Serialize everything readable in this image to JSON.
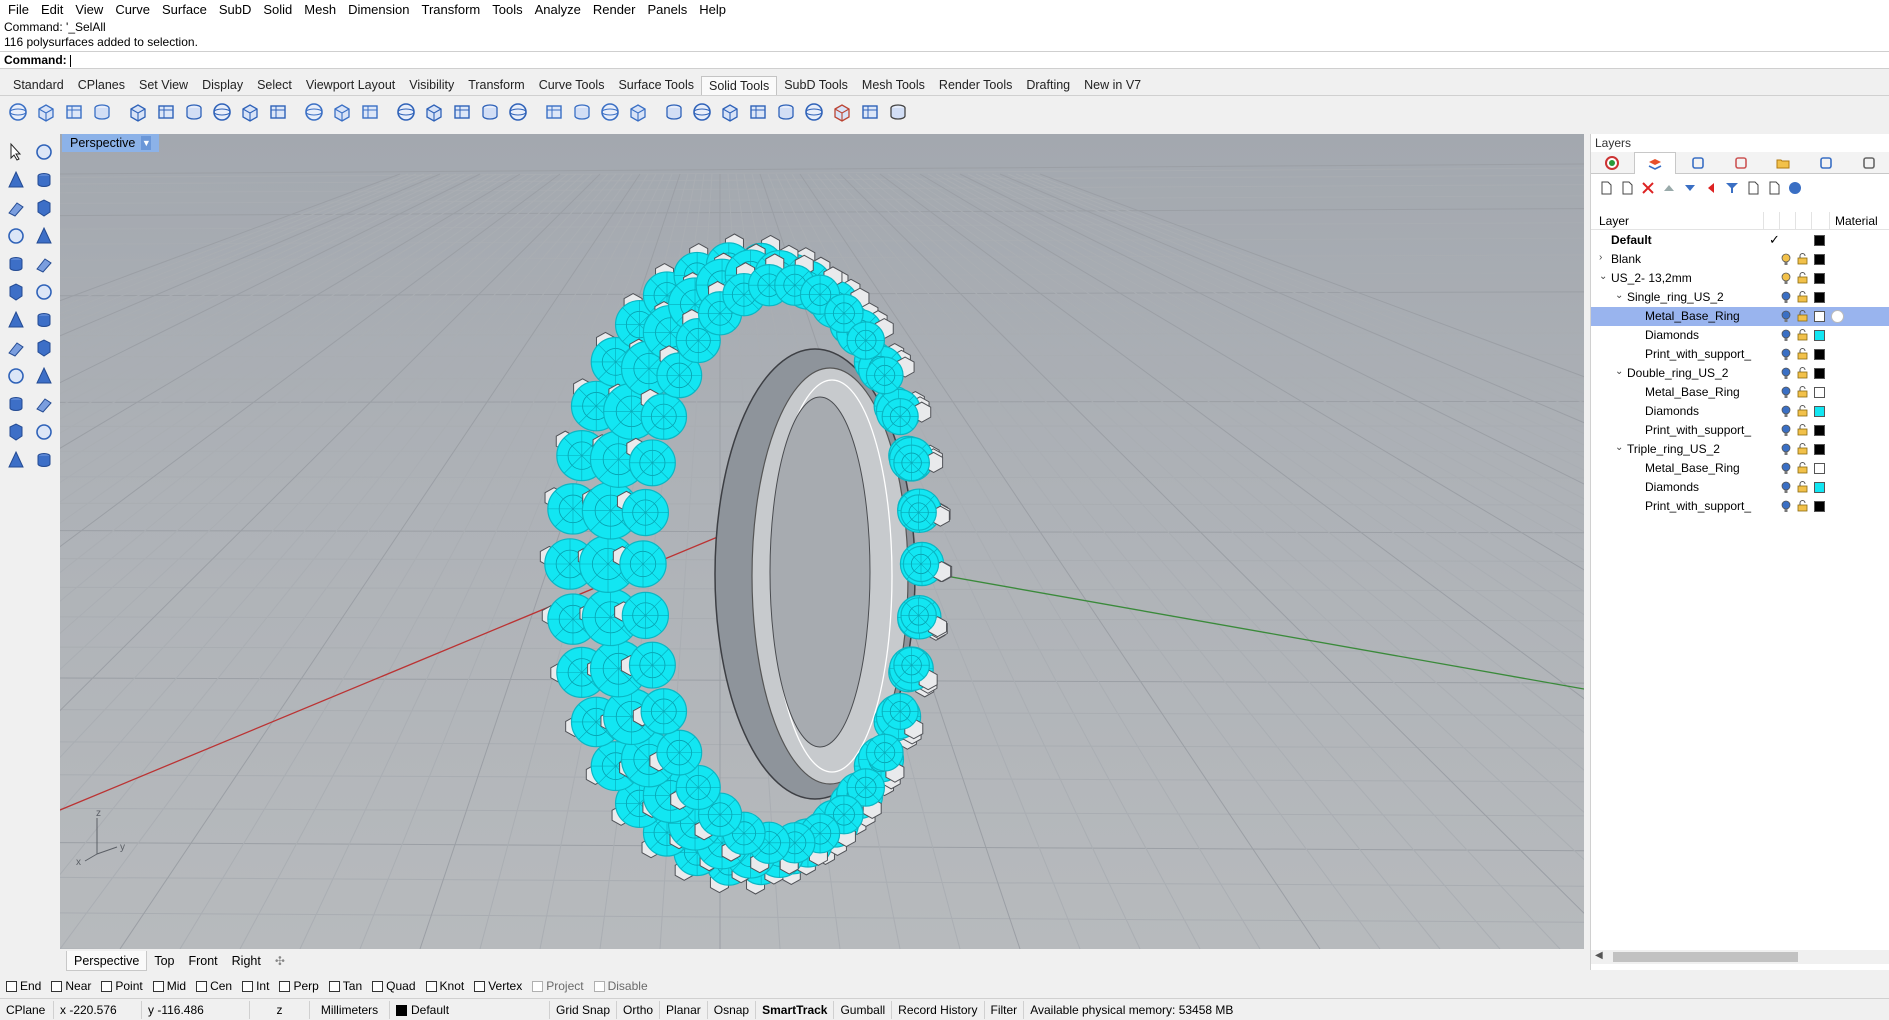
{
  "menu": [
    "File",
    "Edit",
    "View",
    "Curve",
    "Surface",
    "SubD",
    "Solid",
    "Mesh",
    "Dimension",
    "Transform",
    "Tools",
    "Analyze",
    "Render",
    "Panels",
    "Help"
  ],
  "command": {
    "history_1": "Command: '_SelAll",
    "history_2": "116 polysurfaces added to selection.",
    "prompt": "Command:"
  },
  "tabs": [
    "Standard",
    "CPlanes",
    "Set View",
    "Display",
    "Select",
    "Viewport Layout",
    "Visibility",
    "Transform",
    "Curve Tools",
    "Surface Tools",
    "Solid Tools",
    "SubD Tools",
    "Mesh Tools",
    "Render Tools",
    "Drafting",
    "New in V7"
  ],
  "active_tab": "Solid Tools",
  "viewport": {
    "title": "Perspective",
    "axis_x": "x",
    "axis_y": "y",
    "axis_z": "z",
    "object_color": "#12e6f2"
  },
  "viewport_tabs": [
    "Perspective",
    "Top",
    "Front",
    "Right"
  ],
  "osnaps": [
    {
      "label": "End",
      "enabled": true
    },
    {
      "label": "Near",
      "enabled": true
    },
    {
      "label": "Point",
      "enabled": true
    },
    {
      "label": "Mid",
      "enabled": true
    },
    {
      "label": "Cen",
      "enabled": true
    },
    {
      "label": "Int",
      "enabled": true
    },
    {
      "label": "Perp",
      "enabled": true
    },
    {
      "label": "Tan",
      "enabled": true
    },
    {
      "label": "Quad",
      "enabled": true
    },
    {
      "label": "Knot",
      "enabled": true
    },
    {
      "label": "Vertex",
      "enabled": true
    },
    {
      "label": "Project",
      "enabled": false
    },
    {
      "label": "Disable",
      "enabled": false
    }
  ],
  "status": {
    "cplane": "CPlane",
    "x": "x -220.576",
    "y": "y -116.486",
    "z": "z",
    "units": "Millimeters",
    "layer": "Default",
    "grid_snap": "Grid Snap",
    "ortho": "Ortho",
    "planar": "Planar",
    "osnap": "Osnap",
    "smarttrack": "SmartTrack",
    "gumball": "Gumball",
    "record_history": "Record History",
    "filter": "Filter",
    "memory": "Available physical memory: 53458 MB"
  },
  "layers_panel": {
    "title": "Layers",
    "col_layer": "Layer",
    "col_material": "Material",
    "rows": [
      {
        "name": "Default",
        "indent": 0,
        "twisty": "",
        "bold": true,
        "current": true,
        "color": "#000000"
      },
      {
        "name": "Blank",
        "indent": 0,
        "twisty": "›",
        "color": "#000000"
      },
      {
        "name": "US_2- 13,2mm",
        "indent": 0,
        "twisty": "⌄",
        "color": "#000000"
      },
      {
        "name": "Single_ring_US_2",
        "indent": 1,
        "twisty": "⌄",
        "color": "#000000"
      },
      {
        "name": "Metal_Base_Ring",
        "indent": 2,
        "twisty": "",
        "selected": true,
        "color": "#ffffff"
      },
      {
        "name": "Diamonds",
        "indent": 2,
        "twisty": "",
        "color": "#12e6f2"
      },
      {
        "name": "Print_with_support_",
        "indent": 2,
        "twisty": "",
        "color": "#000000"
      },
      {
        "name": "Double_ring_US_2",
        "indent": 1,
        "twisty": "⌄",
        "color": "#000000"
      },
      {
        "name": "Metal_Base_Ring",
        "indent": 2,
        "twisty": "",
        "color": "#ffffff"
      },
      {
        "name": "Diamonds",
        "indent": 2,
        "twisty": "",
        "color": "#12e6f2"
      },
      {
        "name": "Print_with_support_",
        "indent": 2,
        "twisty": "",
        "color": "#000000"
      },
      {
        "name": "Triple_ring_US_2",
        "indent": 1,
        "twisty": "⌄",
        "color": "#000000"
      },
      {
        "name": "Metal_Base_Ring",
        "indent": 2,
        "twisty": "",
        "color": "#ffffff"
      },
      {
        "name": "Diamonds",
        "indent": 2,
        "twisty": "",
        "color": "#12e6f2"
      },
      {
        "name": "Print_with_support_",
        "indent": 2,
        "twisty": "",
        "color": "#000000"
      }
    ]
  }
}
